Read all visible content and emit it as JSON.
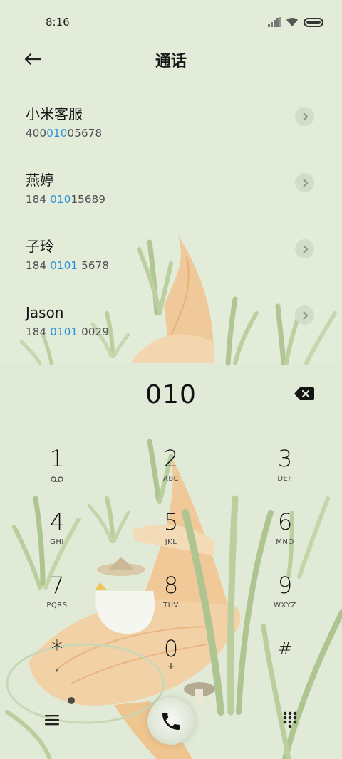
{
  "status_bar": {
    "time": "8:16"
  },
  "header": {
    "title": "通话"
  },
  "contacts": [
    {
      "name": "小米客服",
      "number_pre": "400",
      "number_hl": "010",
      "number_post": "05678"
    },
    {
      "name": "燕婷",
      "number_pre": "184 ",
      "number_hl": "010",
      "number_post": "15689"
    },
    {
      "name": "子玲",
      "number_pre": "184 ",
      "number_hl": "0101",
      "number_post": " 5678"
    },
    {
      "name": "Jason",
      "number_pre": "184 ",
      "number_hl": "0101",
      "number_post": " 0029"
    }
  ],
  "dial": {
    "number": "010"
  },
  "keypad": [
    {
      "digit": "1",
      "letters": ""
    },
    {
      "digit": "2",
      "letters": "ABC"
    },
    {
      "digit": "3",
      "letters": "DEF"
    },
    {
      "digit": "4",
      "letters": "GHI"
    },
    {
      "digit": "5",
      "letters": "JKL"
    },
    {
      "digit": "6",
      "letters": "MNO"
    },
    {
      "digit": "7",
      "letters": "PQRS"
    },
    {
      "digit": "8",
      "letters": "TUV"
    },
    {
      "digit": "9",
      "letters": "WXYZ"
    },
    {
      "digit": "*",
      "letters": ","
    },
    {
      "digit": "0",
      "letters": "+"
    },
    {
      "digit": "#",
      "letters": ""
    }
  ],
  "icons": {
    "back": "arrow-left-icon",
    "detail": "chevron-right-icon",
    "backspace": "backspace-icon",
    "voicemail": "voicemail-icon",
    "menu": "menu-icon",
    "call": "phone-icon",
    "keypad_toggle": "dialpad-icon"
  },
  "colors": {
    "background": "#e3ecd9",
    "highlight": "#2d8fdc"
  }
}
